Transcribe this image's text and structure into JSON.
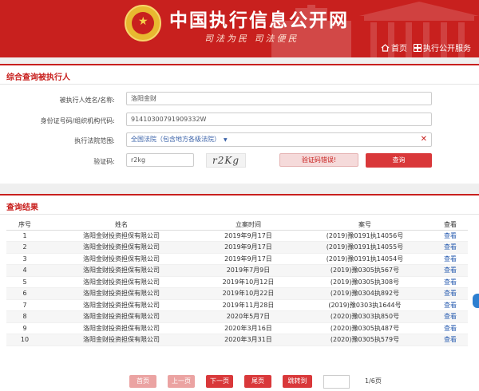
{
  "header": {
    "site_title": "中国执行信息公开网",
    "slogan": "司法为民  司法便民",
    "nav": {
      "home": "首页",
      "service": "执行公开服务"
    }
  },
  "query": {
    "title": "综合查询被执行人",
    "name_label": "被执行人姓名/名称:",
    "name_value": "洛阳金财",
    "id_label": "身份证号码/组织机构代码:",
    "id_value": "91410300791909332W",
    "court_label": "执行法院范围:",
    "court_value": "全国法院（包含地方各级法院）",
    "code_label": "验证码:",
    "code_value": "r2kg",
    "captcha_text": "r2Kg",
    "error_text": "验证码错误!",
    "submit": "查询"
  },
  "results": {
    "title": "查询结果",
    "columns": [
      "序号",
      "姓名",
      "立案时间",
      "案号",
      "查看"
    ],
    "rows": [
      [
        "1",
        "洛阳金财投资担保有限公司",
        "2019年9月17日",
        "(2019)豫0191执14056号",
        "查看"
      ],
      [
        "2",
        "洛阳金财投资担保有限公司",
        "2019年9月17日",
        "(2019)豫0191执14055号",
        "查看"
      ],
      [
        "3",
        "洛阳金财投资担保有限公司",
        "2019年9月17日",
        "(2019)豫0191执14054号",
        "查看"
      ],
      [
        "4",
        "洛阳金财投资担保有限公司",
        "2019年7月9日",
        "(2019)豫0305执567号",
        "查看"
      ],
      [
        "5",
        "洛阳金财投资担保有限公司",
        "2019年10月12日",
        "(2019)豫0305执308号",
        "查看"
      ],
      [
        "6",
        "洛阳金财投资担保有限公司",
        "2019年10月22日",
        "(2019)豫0304执892号",
        "查看"
      ],
      [
        "7",
        "洛阳金财投资担保有限公司",
        "2019年11月28日",
        "(2019)豫0303执1644号",
        "查看"
      ],
      [
        "8",
        "洛阳金财投资担保有限公司",
        "2020年5月7日",
        "(2020)豫0303执850号",
        "查看"
      ],
      [
        "9",
        "洛阳金财投资担保有限公司",
        "2020年3月16日",
        "(2020)豫0305执487号",
        "查看"
      ],
      [
        "10",
        "洛阳金财投资担保有限公司",
        "2020年3月31日",
        "(2020)豫0305执579号",
        "查看"
      ]
    ]
  },
  "pager": {
    "first": "首页",
    "prev": "上一页",
    "next": "下一页",
    "last": "尾页",
    "jump": "跳转到",
    "info": "1/6页"
  },
  "colors": {
    "brand_red": "#c8201e",
    "link_blue": "#2a5db0"
  }
}
